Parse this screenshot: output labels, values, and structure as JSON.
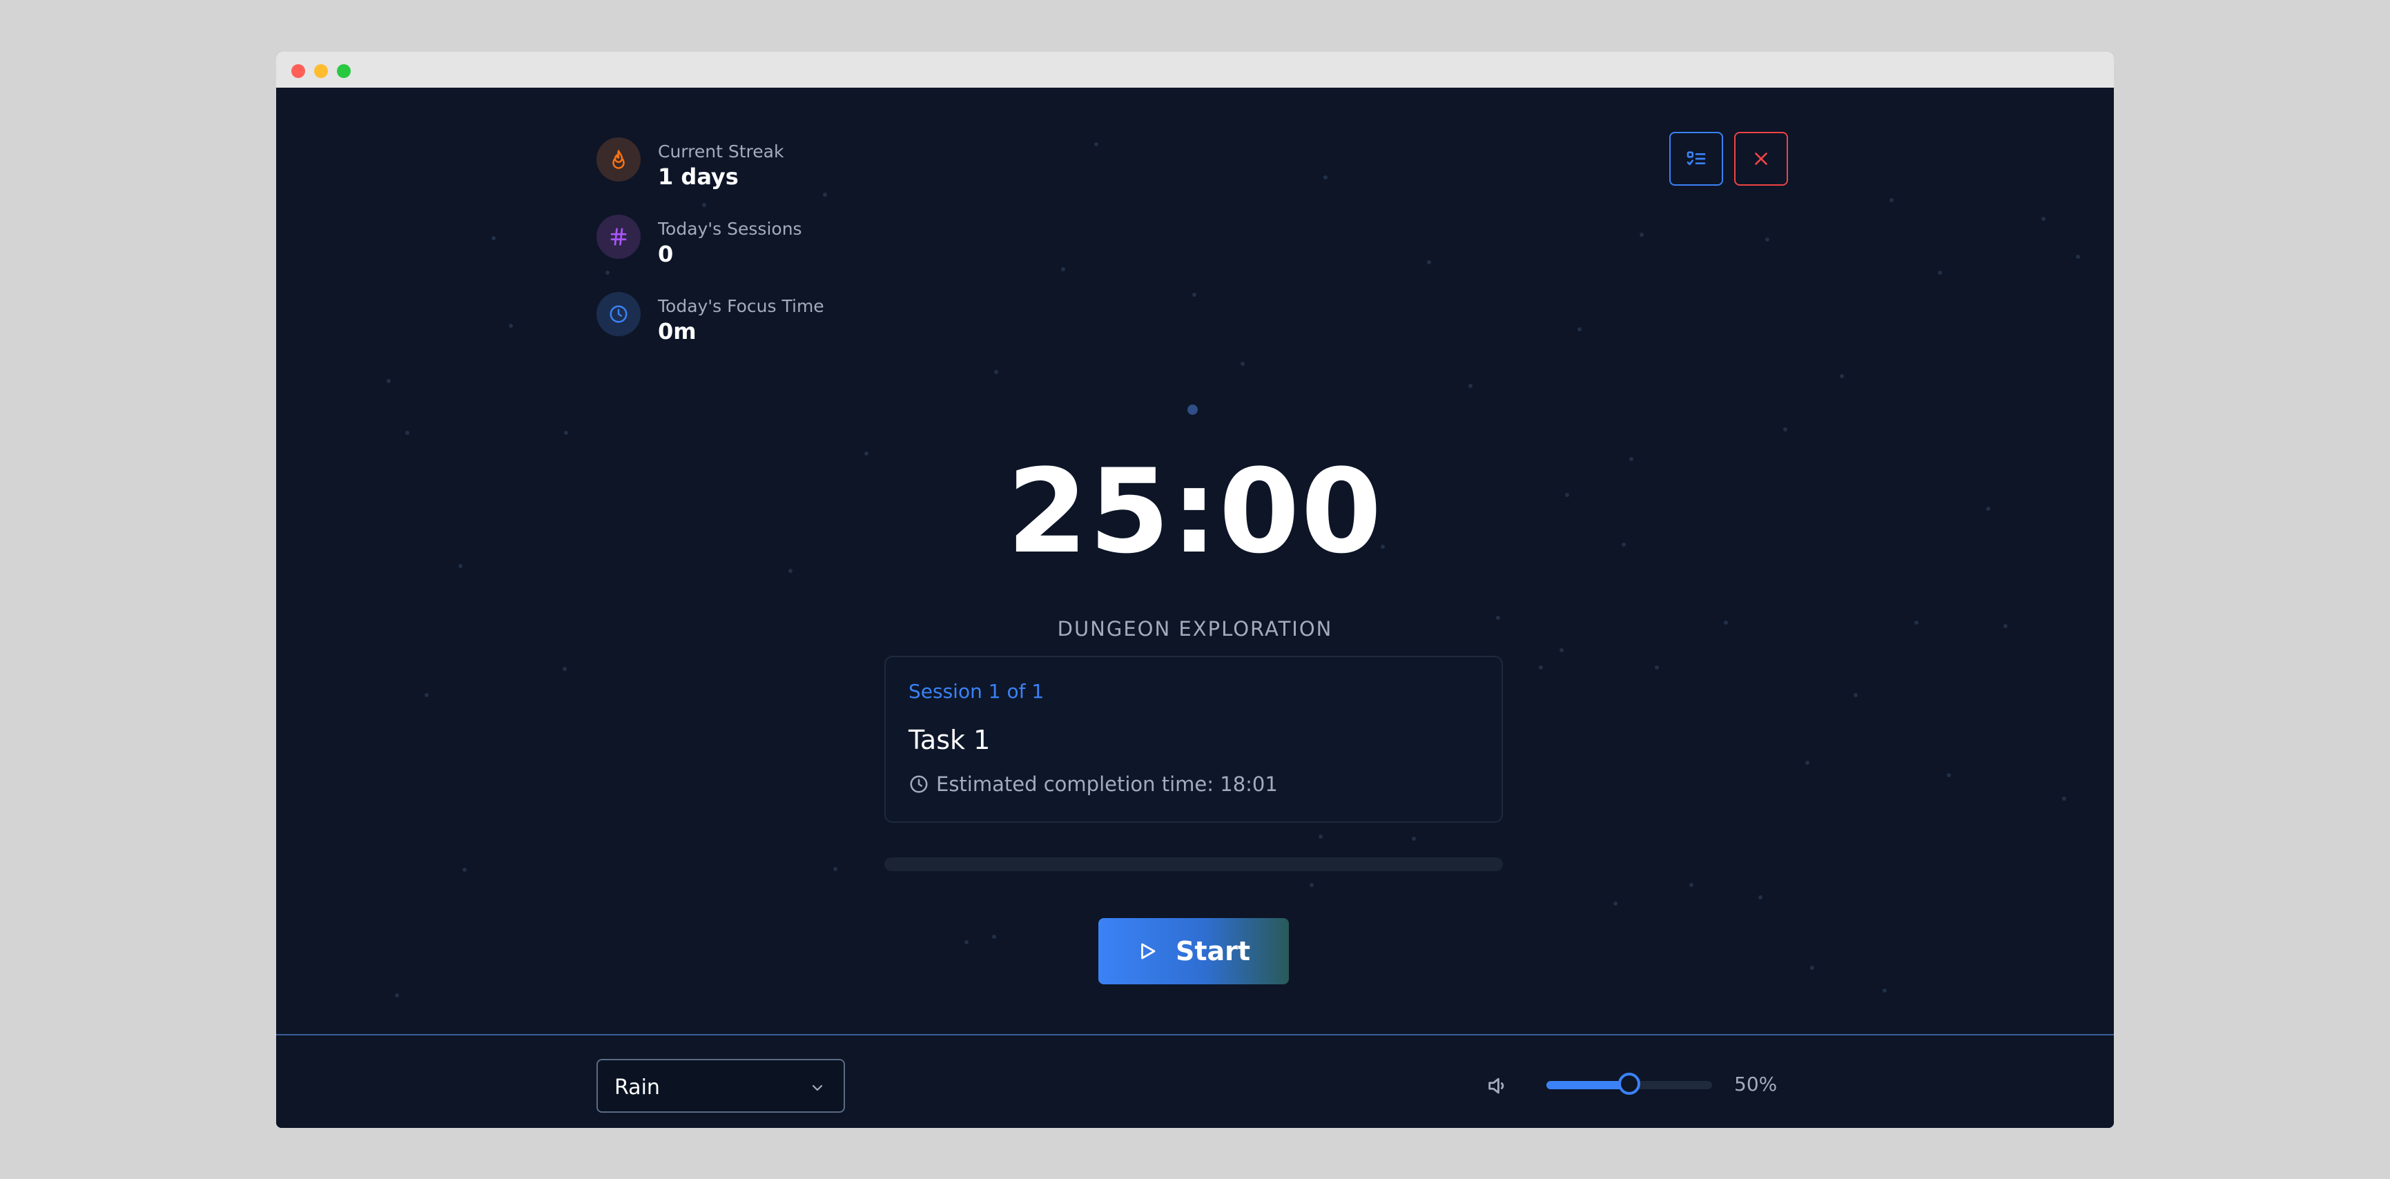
{
  "stats": [
    {
      "label": "Current Streak",
      "value": "1 days",
      "icon": "flame-icon",
      "color": "#f97316"
    },
    {
      "label": "Today's Sessions",
      "value": "0",
      "icon": "hash-icon",
      "color": "#a855f7"
    },
    {
      "label": "Today's Focus Time",
      "value": "0m",
      "icon": "clock-icon",
      "color": "#3b82f6"
    }
  ],
  "header": {
    "tasks_button_icon": "task-list-icon",
    "close_button_icon": "close-icon"
  },
  "timer": {
    "display": "25:00",
    "mode": "DUNGEON EXPLORATION"
  },
  "session": {
    "label": "Session 1 of 1",
    "task": "Task 1",
    "eta": "Estimated completion time: 18:01"
  },
  "progress": {
    "fraction": 0
  },
  "controls": {
    "start_label": "Start"
  },
  "sound": {
    "selected": "Rain"
  },
  "volume": {
    "percent": 50,
    "label": "50%"
  },
  "colors": {
    "accent": "#3b82f6",
    "danger": "#ef4444",
    "streak": "#f97316",
    "sessions": "#a855f7",
    "background": "#0d1527"
  }
}
